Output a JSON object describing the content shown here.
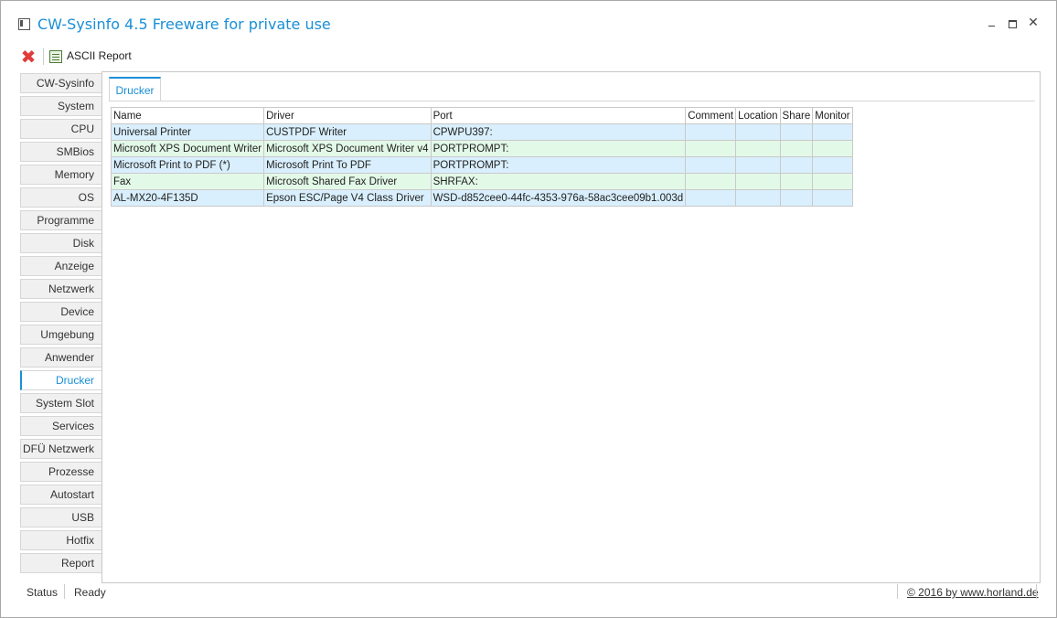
{
  "window": {
    "title": "CW-Sysinfo 4.5 Freeware for private use",
    "minimize_label": "",
    "maximize_label": "",
    "close_label": "✕"
  },
  "toolbar": {
    "close_icon": "red-x-icon",
    "report_icon": "report-icon",
    "report_label": "ASCII Report"
  },
  "sidebar": {
    "items": [
      {
        "label": "CW-Sysinfo"
      },
      {
        "label": "System"
      },
      {
        "label": "CPU"
      },
      {
        "label": "SMBios"
      },
      {
        "label": "Memory"
      },
      {
        "label": "OS"
      },
      {
        "label": "Programme"
      },
      {
        "label": "Disk"
      },
      {
        "label": "Anzeige"
      },
      {
        "label": "Netzwerk"
      },
      {
        "label": "Device"
      },
      {
        "label": "Umgebung"
      },
      {
        "label": "Anwender"
      },
      {
        "label": "Drucker"
      },
      {
        "label": "System Slot"
      },
      {
        "label": "Services"
      },
      {
        "label": "DFÜ Netzwerk"
      },
      {
        "label": "Prozesse"
      },
      {
        "label": "Autostart"
      },
      {
        "label": "USB"
      },
      {
        "label": "Hotfix"
      },
      {
        "label": "Report"
      }
    ],
    "active_index": 13
  },
  "main": {
    "tab_label": "Drucker",
    "table": {
      "columns": [
        "Name",
        "Driver",
        "Port",
        "Comment",
        "Location",
        "Share",
        "Monitor"
      ],
      "rows": [
        [
          "Universal Printer",
          "CUSTPDF Writer",
          "CPWPU397:",
          "",
          "",
          "",
          ""
        ],
        [
          "Microsoft XPS Document Writer",
          "Microsoft XPS Document Writer v4",
          "PORTPROMPT:",
          "",
          "",
          "",
          ""
        ],
        [
          "Microsoft Print to PDF (*)",
          "Microsoft Print To PDF",
          "PORTPROMPT:",
          "",
          "",
          "",
          ""
        ],
        [
          "Fax",
          "Microsoft Shared Fax Driver",
          "SHRFAX:",
          "",
          "",
          "",
          ""
        ],
        [
          "AL-MX20-4F135D",
          "Epson ESC/Page V4 Class Driver",
          "WSD-d852cee0-44fc-4353-976a-58ac3cee09b1.003d",
          "",
          "",
          "",
          ""
        ]
      ]
    }
  },
  "status": {
    "label": "Status",
    "value": "Ready",
    "copyright": "© 2016 by www.horland.de"
  },
  "colors": {
    "accent": "#1a8fd6",
    "row_a": "#d9effd",
    "row_b": "#e3f9e8",
    "close_red": "#e03c3c"
  }
}
